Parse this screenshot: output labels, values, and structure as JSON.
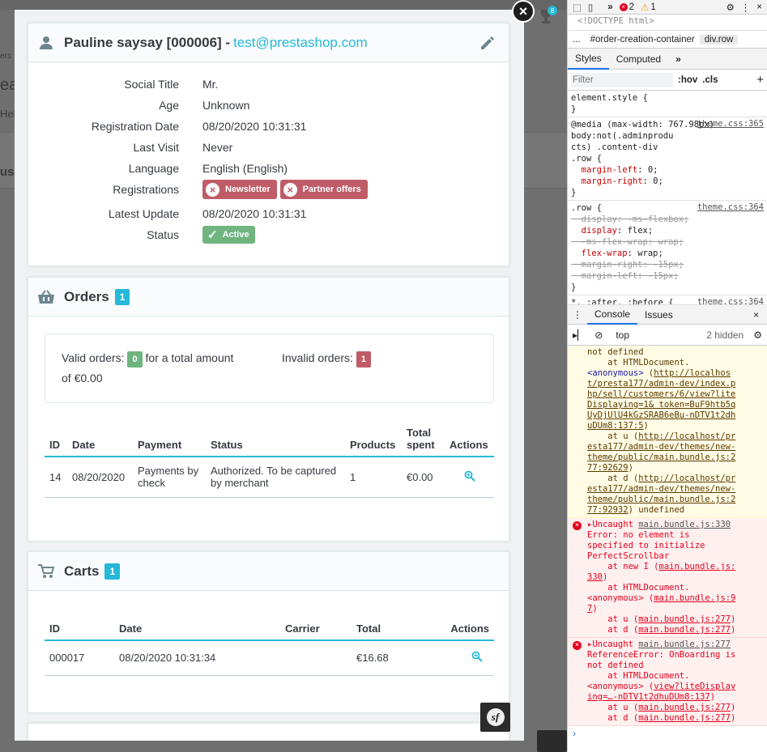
{
  "background": {
    "fragments": [
      "ers",
      "ea",
      "Hel",
      "us"
    ]
  },
  "modal": {
    "close_label": "×",
    "notification_count": "8",
    "customer": {
      "name": "Pauline saysay [000006] - ",
      "email": "test@prestashop.com",
      "fields": [
        {
          "label": "Social Title",
          "value": "Mr."
        },
        {
          "label": "Age",
          "value": "Unknown"
        },
        {
          "label": "Registration Date",
          "value": "08/20/2020 10:31:31"
        },
        {
          "label": "Last Visit",
          "value": "Never"
        },
        {
          "label": "Language",
          "value": "English (English)"
        },
        {
          "label": "Registrations",
          "value": ""
        },
        {
          "label": "Latest Update",
          "value": "08/20/2020 10:31:31"
        },
        {
          "label": "Status",
          "value": ""
        }
      ],
      "registrations": [
        "Newsletter",
        "Partner offers"
      ],
      "status": "Active"
    },
    "orders": {
      "title": "Orders",
      "count": "1",
      "valid_label": "Valid orders:",
      "valid_count": "0",
      "total_text": "for a total amount",
      "total_amount": "of €0.00",
      "invalid_label": "Invalid orders:",
      "invalid_count": "1",
      "columns": [
        "ID",
        "Date",
        "Payment",
        "Status",
        "Products",
        "Total spent",
        "Actions"
      ],
      "rows": [
        {
          "id": "14",
          "date": "08/20/2020",
          "payment": "Payments by check",
          "status": "Authorized. To be captured by merchant",
          "products": "1",
          "total": "€0.00"
        }
      ]
    },
    "carts": {
      "title": "Carts",
      "count": "1",
      "columns": [
        "ID",
        "Date",
        "Carrier",
        "Total",
        "Actions"
      ],
      "rows": [
        {
          "id": "000017",
          "date": "08/20/2020 10:31:34",
          "carrier": "",
          "total": "€16.68"
        }
      ]
    }
  },
  "devtools": {
    "error_count": "2",
    "warning_count": "1",
    "doctype": "<!DOCTYPE html>",
    "breadcrumb": [
      "...",
      "#order-creation-container",
      "div.row"
    ],
    "tabs": [
      "Styles",
      "Computed"
    ],
    "filter_placeholder": "Filter",
    "hov": ":hov",
    "cls": ".cls",
    "console_tabs": [
      "Console",
      "Issues"
    ],
    "context": "top",
    "hidden": "2 hidden",
    "colors": {
      "accent": "#1a73e8",
      "error": "#e4001b"
    }
  }
}
